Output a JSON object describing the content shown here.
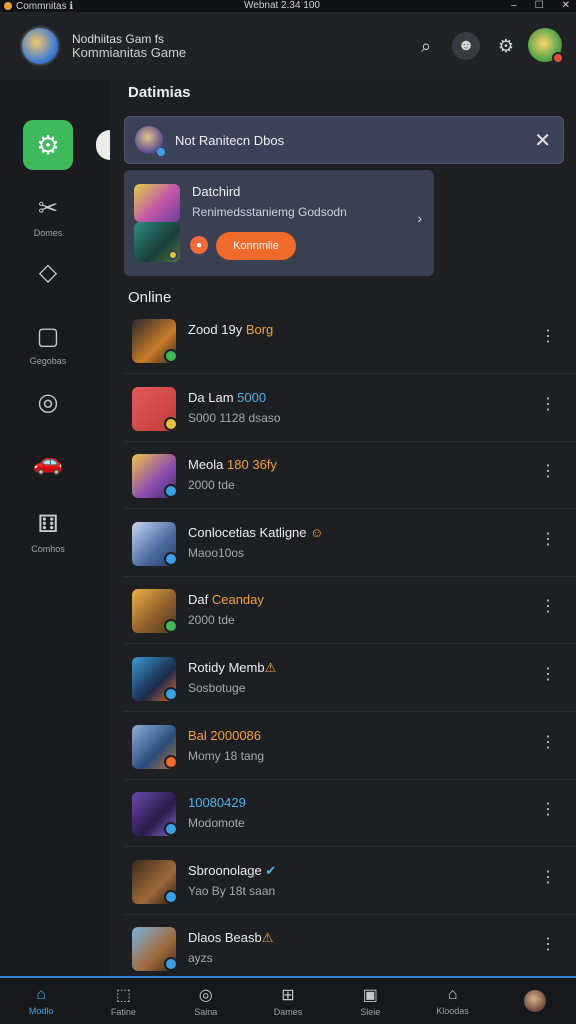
{
  "titlebar": {
    "app": "Commnitas ℹ︎",
    "center": "Webnat 2.34 100",
    "controls": [
      "–",
      "☐",
      "✕"
    ]
  },
  "header": {
    "line1": "Nodhiitas Gam fs",
    "line2": "Kommianitas Game"
  },
  "sidebar": {
    "items": [
      {
        "label": "",
        "icon": "gear-icon",
        "glyph": "⚙"
      },
      {
        "label": "Domes",
        "icon": "tools-icon",
        "glyph": "✂"
      },
      {
        "label": "",
        "icon": "tag-icon",
        "glyph": "◇"
      },
      {
        "label": "Gegobas",
        "icon": "square-icon",
        "glyph": "▢"
      },
      {
        "label": "",
        "icon": "compass-icon",
        "glyph": "◎"
      },
      {
        "label": "",
        "icon": "car-icon",
        "glyph": "🚗"
      },
      {
        "label": "Comhos",
        "icon": "dice-icon",
        "glyph": "⚅"
      }
    ]
  },
  "main": {
    "section1": "Datimias",
    "banner": {
      "text": "Not Ranitecn Dbos",
      "close": "✕"
    },
    "card": {
      "title": "Datchird",
      "subtitle": "Renimedsstaniemg Godsodn",
      "button": "Konnmlie"
    },
    "section2": "Online",
    "friends": [
      {
        "name": "Zood 19y ",
        "hl": "Borg",
        "hlcls": "hl",
        "sub": "",
        "status": "#3fba5a",
        "bg": "linear-gradient(135deg,#2a2a2a,#c87b2a 60%,#3a2a1a)"
      },
      {
        "name": "Da Lam ",
        "hl": "5000",
        "hlcls": "hl-blue",
        "sub": "S000 1128 dsaso",
        "status": "#e6c23a",
        "bg": "linear-gradient(135deg,#e25a5a,#c23a3a)"
      },
      {
        "name": "Meola ",
        "hl": "180 36fy",
        "hlcls": "hl",
        "sub": "2000 tde",
        "status": "#3aa0e6",
        "bg": "linear-gradient(135deg,#f0c34a,#8a4ab0 60%,#3a2a6a)"
      },
      {
        "name": "Conlocetias Katligne ",
        "hl": "☺",
        "hlcls": "hl",
        "sub": "Maoo10os",
        "status": "#3aa0e6",
        "bg": "linear-gradient(135deg,#c7d6f0,#4a6aa0 60%,#2a3a5a)"
      },
      {
        "name": "Daf ",
        "hl": "Ceanday",
        "hlcls": "hl",
        "sub": "2000 tde",
        "status": "#3fba5a",
        "bg": "linear-gradient(135deg,#f0b24a,#8a5a2a 60%,#4a3a1a)"
      },
      {
        "name": "Rotidy Memb",
        "hl": "⚠",
        "hlcls": "hl",
        "sub": "Sosbotuge",
        "status": "#3aa0e6",
        "bg": "linear-gradient(135deg,#3a9ad6,#1a2a4a 60%,#e26a2a)"
      },
      {
        "name": "",
        "hl": "Bal 2000086",
        "hlcls": "hl",
        "sub": "Momy 18 tang",
        "status": "#f06a2c",
        "bg": "linear-gradient(135deg,#8fb0d6,#2a4a7a 60%,#c07a3a)"
      },
      {
        "name": "",
        "hl": "10080429",
        "hlcls": "hl-blue",
        "sub": "Modomote",
        "status": "#3aa0e6",
        "bg": "linear-gradient(135deg,#6a4ab0,#2a1a4a 60%,#8a6ad6)"
      },
      {
        "name": "Sbroonolage ",
        "hl": "✔",
        "hlcls": "hl-blue",
        "sub": "Yao By 18t saan",
        "status": "#3aa0e6",
        "bg": "linear-gradient(135deg,#3a2a1a,#a06a3a 60%,#2a1a10)"
      },
      {
        "name": "Dlaos Beasb",
        "hl": "⚠",
        "hlcls": "hl",
        "sub": "ayzs",
        "status": "#3aa0e6",
        "bg": "linear-gradient(135deg,#7ab0e0,#a06a3a 60%,#3a2a1a)"
      }
    ]
  },
  "bottomnav": [
    {
      "label": "Modlo",
      "glyph": "⌂",
      "icon": "home-icon"
    },
    {
      "label": "Fatine",
      "glyph": "⬚",
      "icon": "window-icon"
    },
    {
      "label": "Saina",
      "glyph": "◎",
      "icon": "target-icon"
    },
    {
      "label": "Dames",
      "glyph": "⊞",
      "icon": "grid-icon"
    },
    {
      "label": "Sleie",
      "glyph": "▣",
      "icon": "card-icon"
    },
    {
      "label": "Kloodas",
      "glyph": "⌂",
      "icon": "shop-icon"
    },
    {
      "label": "",
      "glyph": "",
      "icon": "avatar-icon"
    }
  ],
  "colors": {
    "accent": "#3fba5a",
    "cta": "#f06a2c",
    "selected_nav": "#3fa7e8"
  }
}
